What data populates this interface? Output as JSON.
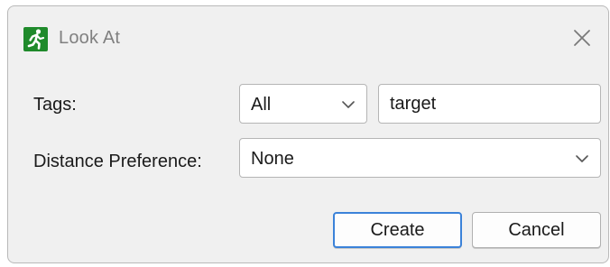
{
  "window": {
    "title": "Look At",
    "icon": "running-man-icon",
    "close_icon": "close-icon"
  },
  "form": {
    "tags": {
      "label": "Tags:",
      "mode_value": "All",
      "text_value": "target"
    },
    "distance": {
      "label": "Distance Preference:",
      "value": "None"
    }
  },
  "buttons": {
    "create": "Create",
    "cancel": "Cancel"
  },
  "colors": {
    "icon_bg": "#1f8a2b",
    "default_button_border": "#3b82d9",
    "dialog_bg": "#f0f0f0"
  }
}
